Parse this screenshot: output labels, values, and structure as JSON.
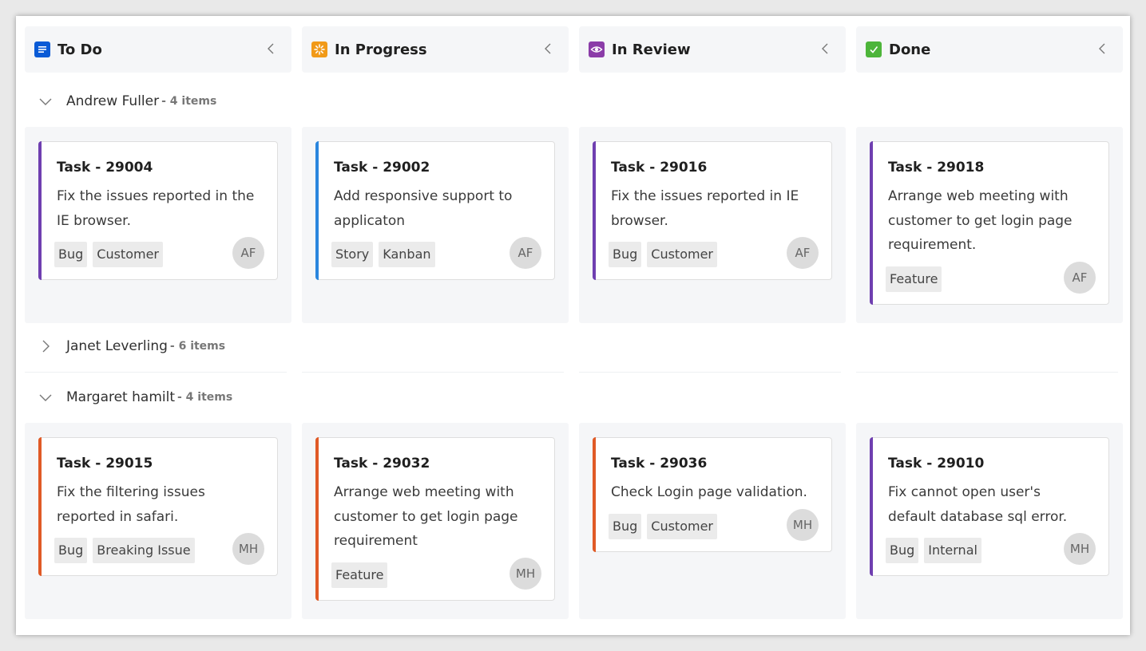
{
  "columns": [
    {
      "title": "To Do",
      "icon": "document-list-icon",
      "color": "#0a5bd6"
    },
    {
      "title": "In Progress",
      "icon": "sunburst-icon",
      "color": "#f19a18"
    },
    {
      "title": "In Review",
      "icon": "eye-icon",
      "color": "#8b3ca8"
    },
    {
      "title": "Done",
      "icon": "checkmark-icon",
      "color": "#4db53a"
    }
  ],
  "swimlanes": [
    {
      "name": "Andrew Fuller",
      "count": "- 4 items",
      "expanded": true
    },
    {
      "name": "Janet Leverling",
      "count": "- 6 items",
      "expanded": false
    },
    {
      "name": "Margaret hamilt",
      "count": "- 4 items",
      "expanded": true
    }
  ],
  "cards": [
    {
      "title": "Task - 29004",
      "desc": "Fix the issues reported in the IE browser.",
      "tags": [
        "Bug",
        "Customer"
      ],
      "assignee": "AF",
      "accent": "#6f3fb0"
    },
    {
      "title": "Task - 29002",
      "desc": "Add responsive support to applicaton",
      "tags": [
        "Story",
        "Kanban"
      ],
      "assignee": "AF",
      "accent": "#2a86de"
    },
    {
      "title": "Task - 29016",
      "desc": "Fix the issues reported in IE browser.",
      "tags": [
        "Bug",
        "Customer"
      ],
      "assignee": "AF",
      "accent": "#6f3fb0"
    },
    {
      "title": "Task - 29018",
      "desc": "Arrange web meeting with customer to get login page requirement.",
      "tags": [
        "Feature"
      ],
      "assignee": "AF",
      "accent": "#6f3fb0"
    },
    {
      "title": "Task - 29015",
      "desc": "Fix the filtering issues reported in safari.",
      "tags": [
        "Bug",
        "Breaking Issue"
      ],
      "assignee": "MH",
      "accent": "#e05a26"
    },
    {
      "title": "Task - 29032",
      "desc": "Arrange web meeting with customer to get login page requirement",
      "tags": [
        "Feature"
      ],
      "assignee": "MH",
      "accent": "#e05a26"
    },
    {
      "title": "Task - 29036",
      "desc": "Check Login page validation.",
      "tags": [
        "Bug",
        "Customer"
      ],
      "assignee": "MH",
      "accent": "#e05a26"
    },
    {
      "title": "Task - 29010",
      "desc": "Fix cannot open user's default database sql error.",
      "tags": [
        "Bug",
        "Internal"
      ],
      "assignee": "MH",
      "accent": "#6f3fb0"
    }
  ]
}
